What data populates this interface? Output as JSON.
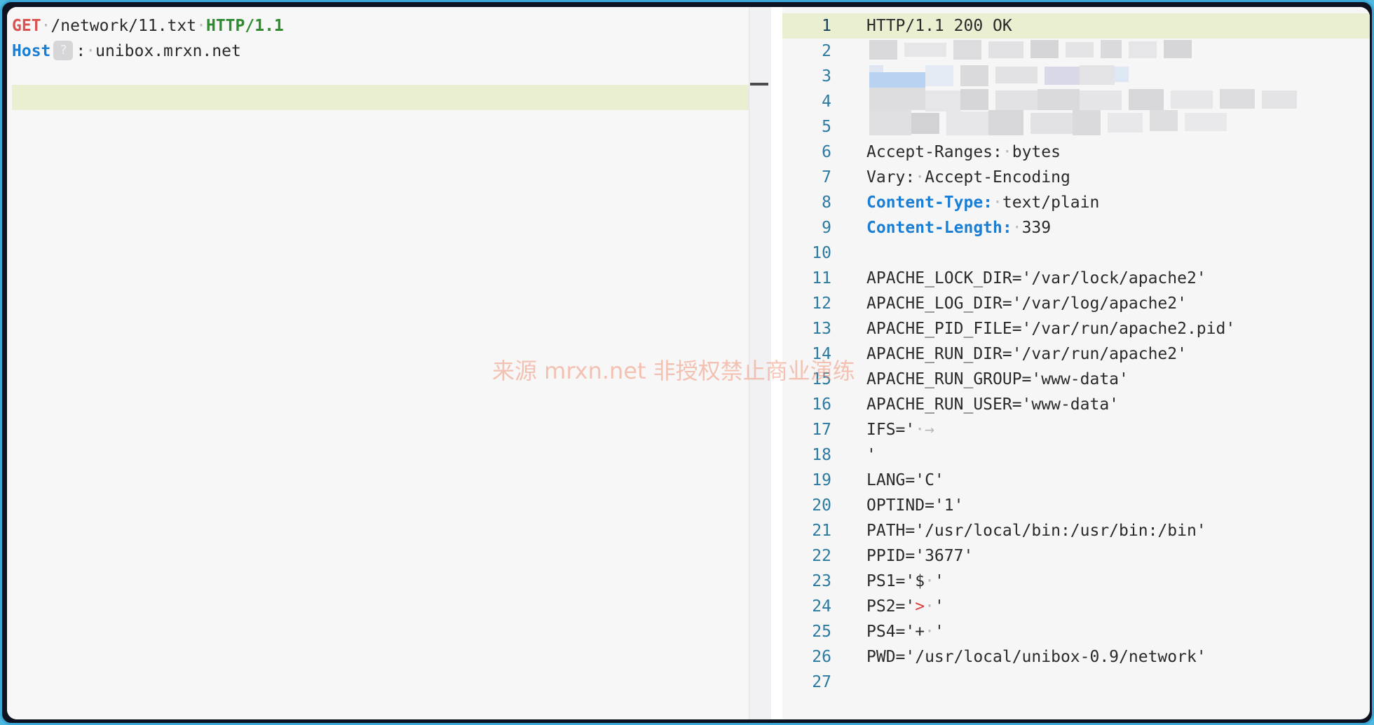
{
  "request": {
    "line1": {
      "method": "GET",
      "path": "/network/11.txt",
      "protocol": "HTTP/1.1"
    },
    "line2": {
      "key": "Host",
      "badge": "?",
      "sep": ":",
      "value": "unibox.mrxn.net"
    }
  },
  "response": {
    "line_numbers": [
      "1",
      "2",
      "3",
      "4",
      "5",
      "6",
      "7",
      "8",
      "9",
      "10",
      "11",
      "12",
      "13",
      "14",
      "15",
      "16",
      "17",
      "18",
      "19",
      "20",
      "21",
      "22",
      "23",
      "24",
      "25",
      "26",
      "27"
    ],
    "status": "HTTP/1.1 200 OK",
    "header_accept_ranges": {
      "key": "Accept-Ranges:",
      "value": "bytes"
    },
    "header_vary": {
      "key": "Vary:",
      "value": "Accept-Encoding"
    },
    "header_content_type": {
      "key": "Content-Type:",
      "value": "text/plain"
    },
    "header_content_length": {
      "key": "Content-Length:",
      "value": "339"
    },
    "body": {
      "l11": "APACHE_LOCK_DIR='/var/lock/apache2'",
      "l12": "APACHE_LOG_DIR='/var/log/apache2'",
      "l13": "APACHE_PID_FILE='/var/run/apache2.pid'",
      "l14": "APACHE_RUN_DIR='/var/run/apache2'",
      "l15": "APACHE_RUN_GROUP='www-data'",
      "l16": "APACHE_RUN_USER='www-data'",
      "l17_a": "IFS='",
      "l17_b": "→",
      "l18": "'",
      "l19": "LANG='C'",
      "l20": "OPTIND='1'",
      "l21": "PATH='/usr/local/bin:/usr/bin:/bin'",
      "l22": "PPID='3677'",
      "l23_a": "PS1='$",
      "l23_b": "'",
      "l24_a": "PS2='",
      "l24_red": ">",
      "l24_b": "'",
      "l25_a": "PS4='+",
      "l25_b": "'",
      "l26": "PWD='/usr/local/unibox-0.9/network'"
    }
  },
  "watermark": "来源 mrxn.net 非授权禁止商业演练",
  "colors": {
    "method": "#d9534f",
    "protocol": "#2e8b2e",
    "header_key": "#1a7fd4",
    "line_number": "#2c7aa0",
    "highlight": "#e9efd0",
    "frame": "#3aa7d6"
  }
}
